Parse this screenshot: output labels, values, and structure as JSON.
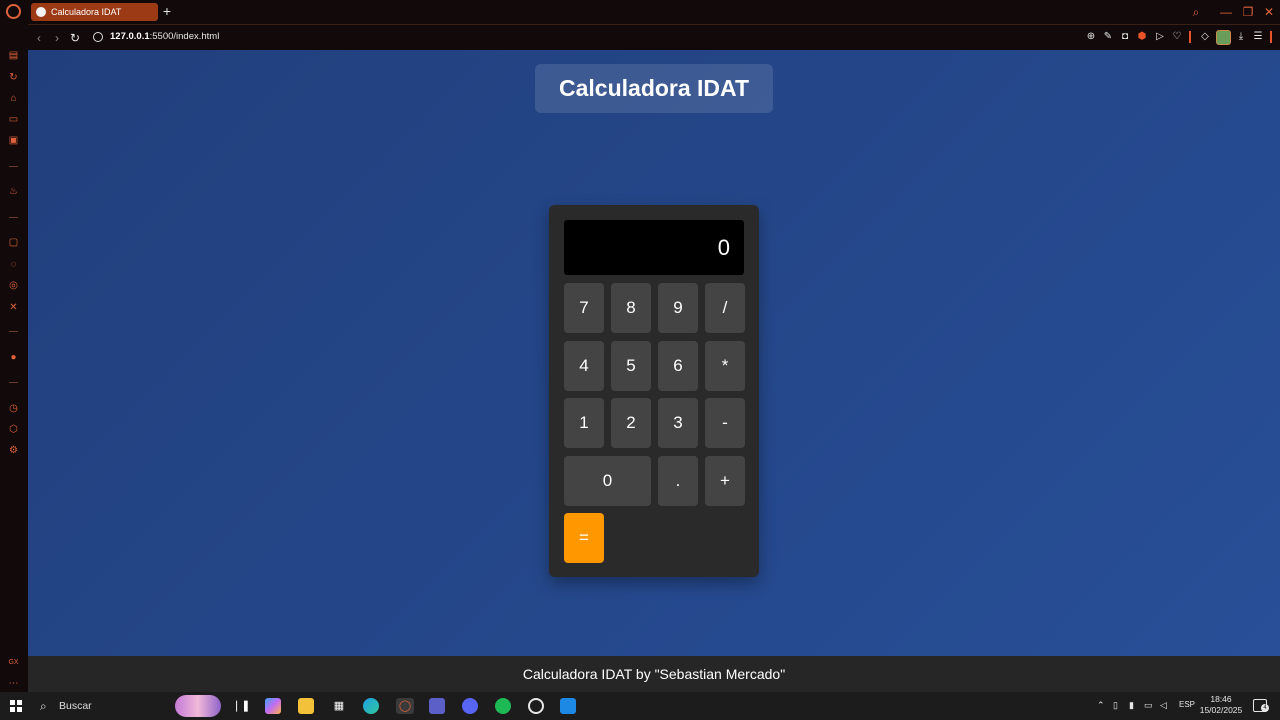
{
  "browser": {
    "tab_title": "Calculadora IDAT",
    "new_tab_label": "+",
    "url_host": "127.0.0.1",
    "url_rest": ":5500/index.html",
    "window_controls": {
      "search": "⌕",
      "minimize": "—",
      "maximize": "❐",
      "close": "✕"
    },
    "nav": {
      "back": "‹",
      "forward": "›",
      "reload": "↻"
    },
    "toolbar_icons": [
      "zoom-icon",
      "edit-icon",
      "camera-icon",
      "shield-icon",
      "play-icon",
      "heart-icon",
      "cube-icon",
      "avatar",
      "download-icon",
      "menu-icon"
    ]
  },
  "sidebar": {
    "icons": [
      "news-icon",
      "refresh-icon",
      "shop-icon",
      "tv-icon",
      "ai-icon",
      "flame-icon",
      "twitch-icon",
      "whatsapp-icon",
      "instagram-icon",
      "x-icon",
      "spotify-icon",
      "history-icon",
      "extensions-icon",
      "settings-icon",
      "gx-icon",
      "more-icon"
    ]
  },
  "page": {
    "title": "Calculadora IDAT",
    "display_value": "0",
    "keys": [
      "7",
      "8",
      "9",
      "/",
      "4",
      "5",
      "6",
      "*",
      "1",
      "2",
      "3",
      "-",
      "0",
      ".",
      "+",
      "="
    ],
    "footer": "Calculadora IDAT by \"Sebastian Mercado\""
  },
  "colors": {
    "page_bg": "#25488c",
    "calc_bg": "#2a2a2a",
    "key_bg": "#444444",
    "equals_bg": "#ff9800",
    "opera_accent": "#e0623a"
  },
  "taskbar": {
    "search_placeholder": "Buscar",
    "language": "ESP",
    "time": "18:46",
    "date": "15/02/2025",
    "notifications": "4",
    "apps": [
      "task-view-icon",
      "copilot-icon",
      "file-explorer-icon",
      "store-icon",
      "edge-icon",
      "opera-icon",
      "teams-icon",
      "discord-icon",
      "spotify-icon",
      "whatsapp-icon",
      "vscode-icon"
    ]
  }
}
